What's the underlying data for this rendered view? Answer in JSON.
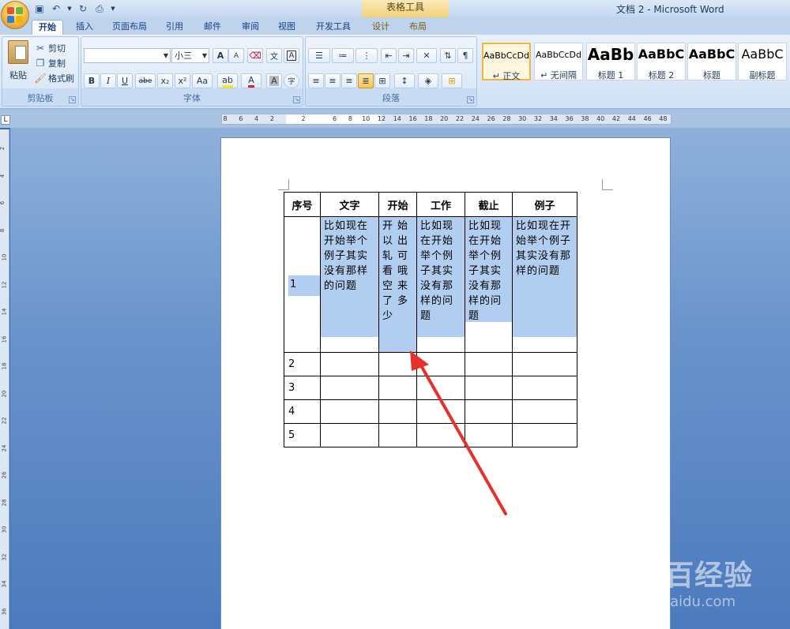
{
  "titlebar": {
    "table_tools": "表格工具",
    "doc_title": "文档 2 - Microsoft Word"
  },
  "tabs": [
    {
      "label": "开始"
    },
    {
      "label": "插入"
    },
    {
      "label": "页面布局"
    },
    {
      "label": "引用"
    },
    {
      "label": "邮件"
    },
    {
      "label": "审阅"
    },
    {
      "label": "视图"
    },
    {
      "label": "开发工具"
    },
    {
      "label": "设计"
    },
    {
      "label": "布局"
    }
  ],
  "clipboard": {
    "paste": "粘贴",
    "cut": "剪切",
    "copy": "复制",
    "format_painter": "格式刷",
    "label": "剪贴板"
  },
  "font": {
    "font_name": "",
    "font_size": "小三",
    "label": "字体",
    "bold": "B",
    "italic": "I",
    "underline": "U",
    "strike": "abe",
    "subscript": "x₂",
    "superscript": "x²",
    "change_case": "Aa",
    "grow": "A",
    "shrink": "A",
    "font_color": "A",
    "char_shading": "A",
    "enclose": "字",
    "wen": "文"
  },
  "paragraph": {
    "label": "段落"
  },
  "styles": [
    {
      "sample": "AaBbCcDd",
      "name": "↵ 正文"
    },
    {
      "sample": "AaBbCcDd",
      "name": "↵ 无间隔"
    },
    {
      "sample": "AaBb",
      "name": "标题 1"
    },
    {
      "sample": "AaBbC",
      "name": "标题 2"
    },
    {
      "sample": "AaBbC",
      "name": "标题"
    },
    {
      "sample": "AaBbC",
      "name": "副标题"
    }
  ],
  "ruler": {
    "h_numbers": [
      "8",
      "6",
      "4",
      "2",
      "",
      "2",
      "",
      "6",
      "8",
      "10",
      "12",
      "14",
      "16",
      "18",
      "20",
      "22",
      "24",
      "26",
      "28",
      "30",
      "32",
      "34",
      "36",
      "38",
      "40",
      "42",
      "44",
      "46",
      "48"
    ],
    "v_numbers": [
      "2",
      "4",
      "6",
      "8",
      "10",
      "12",
      "14",
      "16",
      "18",
      "20",
      "22",
      "24",
      "26",
      "28",
      "30",
      "32",
      "34",
      "36"
    ]
  },
  "table": {
    "headers": [
      "序号",
      "文字",
      "开始",
      "工作",
      "截止",
      "例子"
    ],
    "row1": {
      "num": "1",
      "cells": [
        "比如现在开始举个例子其实没有那样的问题",
        "开始以出轧可看哦空来了多少",
        "比如现在开始举个例子其实没有那样的问题",
        "比如现在开始举个例子其实没有那样的问题",
        "比如现在开始举个例子其实没有那样的问题"
      ]
    },
    "row_nums": [
      "2",
      "3",
      "4",
      "5"
    ]
  },
  "watermark": {
    "main": "Bai百经验",
    "sub": "jingyan.baidu.com"
  },
  "colors": {
    "arrow": "#e8302a",
    "selection": "#b1cdf0",
    "ribbon": "#d0e1f6"
  }
}
